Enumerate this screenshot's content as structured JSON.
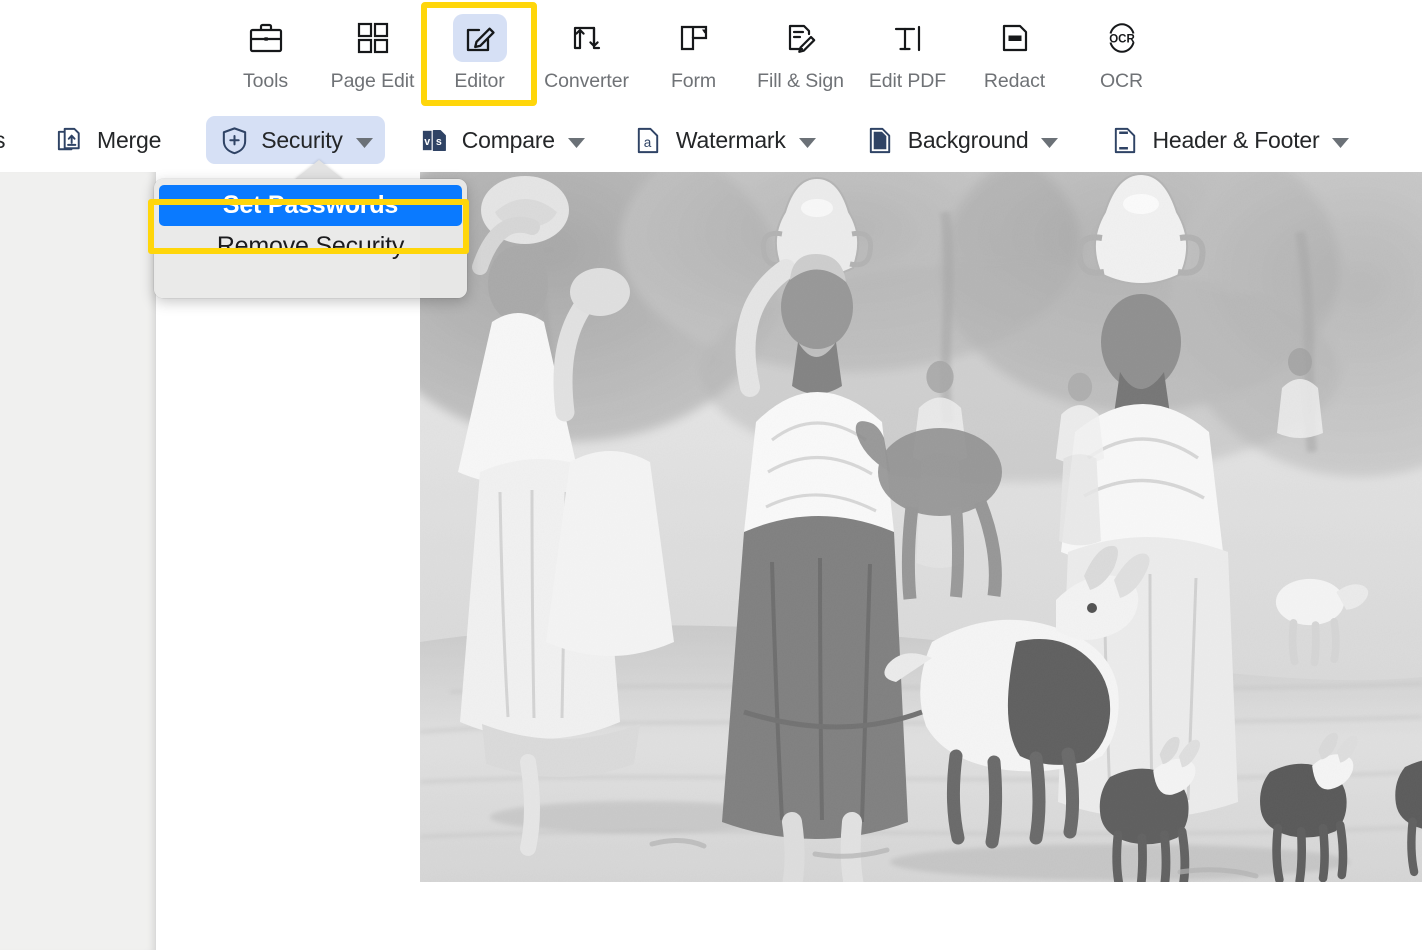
{
  "app": {
    "accent_blue": "#0a7aff",
    "highlight_yellow": "#FFD60A",
    "icon_navy": "#2f4365",
    "selected_chip_bg": "#d6e0f5"
  },
  "toolbar": {
    "primary_tools": [
      {
        "id": "tools",
        "label": "Tools",
        "icon": "briefcase-icon",
        "selected": false
      },
      {
        "id": "page-edit",
        "label": "Page Edit",
        "icon": "grid-squares-icon",
        "selected": false
      },
      {
        "id": "editor",
        "label": "Editor",
        "icon": "edit-square-icon",
        "selected": true
      },
      {
        "id": "converter",
        "label": "Converter",
        "icon": "convert-arrows-icon",
        "selected": false
      },
      {
        "id": "form",
        "label": "Form",
        "icon": "form-layout-icon",
        "selected": false
      },
      {
        "id": "fill-sign",
        "label": "Fill & Sign",
        "icon": "sign-pencil-icon",
        "selected": false
      },
      {
        "id": "edit-pdf",
        "label": "Edit PDF",
        "icon": "text-cursor-icon",
        "selected": false
      },
      {
        "id": "redact",
        "label": "Redact",
        "icon": "redact-bar-icon",
        "selected": false
      },
      {
        "id": "ocr",
        "label": "OCR",
        "icon": "ocr-circle-icon",
        "selected": false
      }
    ],
    "secondary_edge_fragment": "s",
    "secondary_tools": [
      {
        "id": "merge",
        "label": "Merge",
        "icon": "merge-docs-icon",
        "has_caret": false,
        "active": false
      },
      {
        "id": "security",
        "label": "Security",
        "icon": "shield-plus-icon",
        "has_caret": true,
        "active": true
      },
      {
        "id": "compare",
        "label": "Compare",
        "icon": "compare-vs-icon",
        "has_caret": true,
        "active": false
      },
      {
        "id": "watermark",
        "label": "Watermark",
        "icon": "watermark-a-icon",
        "has_caret": true,
        "active": false
      },
      {
        "id": "background",
        "label": "Background",
        "icon": "background-page-icon",
        "has_caret": true,
        "active": false
      },
      {
        "id": "header-footer",
        "label": "Header & Footer",
        "icon": "header-footer-icon",
        "has_caret": true,
        "active": false
      }
    ]
  },
  "security_menu": {
    "items": [
      {
        "id": "set-passwords",
        "label": "Set Passwords",
        "highlighted": true
      },
      {
        "id": "remove-security",
        "label": "Remove Security",
        "highlighted": false
      }
    ]
  },
  "document": {
    "illustration_alt": "Grayscale engraving of women carrying water jars on their heads walking along a path with goats"
  }
}
